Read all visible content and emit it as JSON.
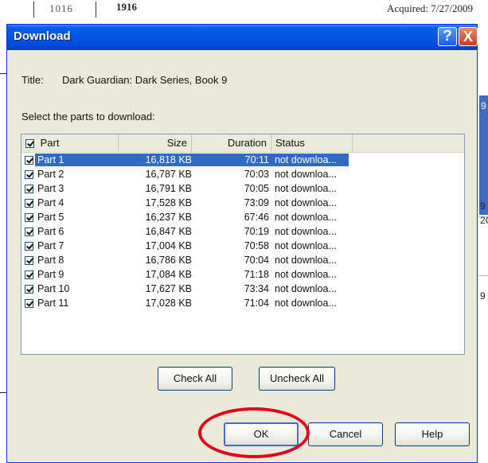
{
  "background": {
    "top_number_1": "1016",
    "top_number_2": "1916",
    "acquired_text": "Acquired: 7/27/2009",
    "right_chars": [
      "9",
      "9",
      "2C",
      "9"
    ]
  },
  "dialog": {
    "title": "Download",
    "help_glyph": "?",
    "close_glyph": "X",
    "title_label": "Title:",
    "title_value": "Dark Guardian: Dark Series, Book 9",
    "instruction": "Select the parts to download:"
  },
  "list": {
    "columns": {
      "part": "Part",
      "size": "Size",
      "duration": "Duration",
      "status": "Status"
    },
    "rows": [
      {
        "part": "Part 1",
        "size": "16,818 KB",
        "duration": "70:11",
        "status": "not downloa...",
        "checked": true,
        "selected": true
      },
      {
        "part": "Part 2",
        "size": "16,787 KB",
        "duration": "70:03",
        "status": "not downloa...",
        "checked": true
      },
      {
        "part": "Part 3",
        "size": "16,791 KB",
        "duration": "70:05",
        "status": "not downloa...",
        "checked": true
      },
      {
        "part": "Part 4",
        "size": "17,528 KB",
        "duration": "73:09",
        "status": "not downloa...",
        "checked": true
      },
      {
        "part": "Part 5",
        "size": "16,237 KB",
        "duration": "67:46",
        "status": "not downloa...",
        "checked": true
      },
      {
        "part": "Part 6",
        "size": "16,847 KB",
        "duration": "70:19",
        "status": "not downloa...",
        "checked": true
      },
      {
        "part": "Part 7",
        "size": "17,004 KB",
        "duration": "70:58",
        "status": "not downloa...",
        "checked": true
      },
      {
        "part": "Part 8",
        "size": "16,786 KB",
        "duration": "70:04",
        "status": "not downloa...",
        "checked": true
      },
      {
        "part": "Part 9",
        "size": "17,084 KB",
        "duration": "71:18",
        "status": "not downloa...",
        "checked": true
      },
      {
        "part": "Part 10",
        "size": "17,627 KB",
        "duration": "73:34",
        "status": "not downloa...",
        "checked": true
      },
      {
        "part": "Part 11",
        "size": "17,028 KB",
        "duration": "71:04",
        "status": "not downloa...",
        "checked": true
      }
    ]
  },
  "buttons": {
    "check_all": "Check All",
    "uncheck_all": "Uncheck All",
    "ok": "OK",
    "cancel": "Cancel",
    "help": "Help"
  },
  "colors": {
    "selection": "#316ac5",
    "titlebar": "#0054e3",
    "highlight_ring": "#e2001a"
  }
}
